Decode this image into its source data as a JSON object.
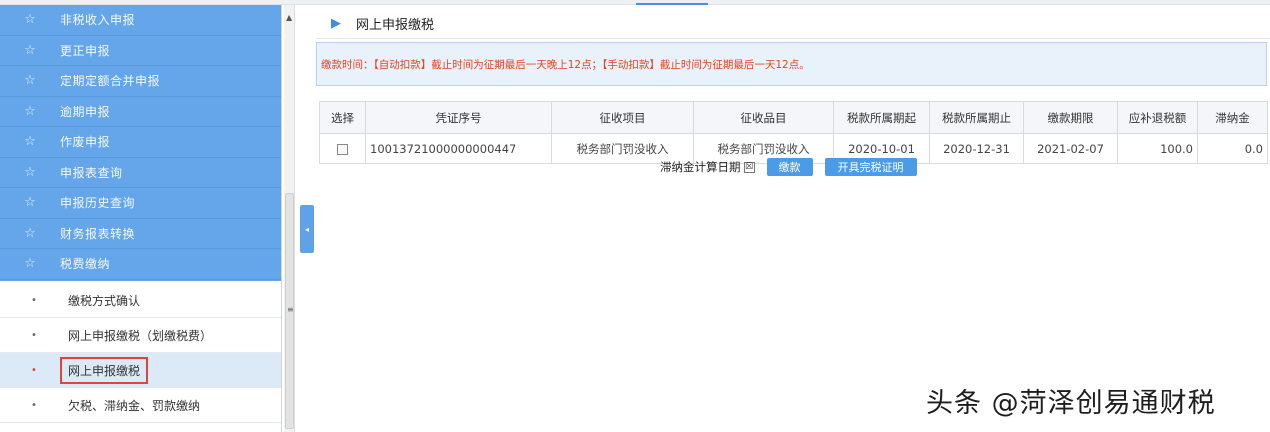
{
  "sidebar": {
    "menu_items": [
      {
        "label": "非税收入申报"
      },
      {
        "label": "更正申报"
      },
      {
        "label": "定期定额合并申报"
      },
      {
        "label": "逾期申报"
      },
      {
        "label": "作废申报"
      },
      {
        "label": "申报表查询"
      },
      {
        "label": "申报历史查询"
      },
      {
        "label": "财务报表转换"
      },
      {
        "label": "税费缴纳"
      }
    ],
    "sub_items": [
      {
        "label": "缴税方式确认"
      },
      {
        "label": "网上申报缴税（划缴税费）"
      },
      {
        "label": "网上申报缴税"
      },
      {
        "label": "欠税、滞纳金、罚款缴纳"
      }
    ],
    "selected_sub_index": 2
  },
  "main": {
    "title": "网上申报缴税",
    "notice": "缴款时间：【自动扣款】截止时间为征期最后一天晚上12点；【手动扣款】截止时间为征期最后一天12点。",
    "table": {
      "headers": [
        "选择",
        "凭证序号",
        "征收项目",
        "征收品目",
        "税款所属期起",
        "税款所属期止",
        "缴款期限",
        "应补退税额",
        "滞纳金"
      ],
      "rows": [
        [
          "",
          "10013721000000000447",
          "税务部门罚没收入",
          "税务部门罚没收入",
          "2020-10-01",
          "2020-12-31",
          "2021-02-07",
          "100.0",
          "0.0"
        ]
      ]
    },
    "actions": {
      "late_fee_label": "滞纳金计算日期",
      "pay_button": "缴款",
      "cert_button": "开具完税证明"
    }
  },
  "watermark": "头条 @菏泽创易通财税",
  "colors": {
    "sidebar_blue": "#64a6e9",
    "accent_blue": "#4a9be8",
    "notice_red": "#e8431f",
    "selection_red": "#e0443a"
  }
}
